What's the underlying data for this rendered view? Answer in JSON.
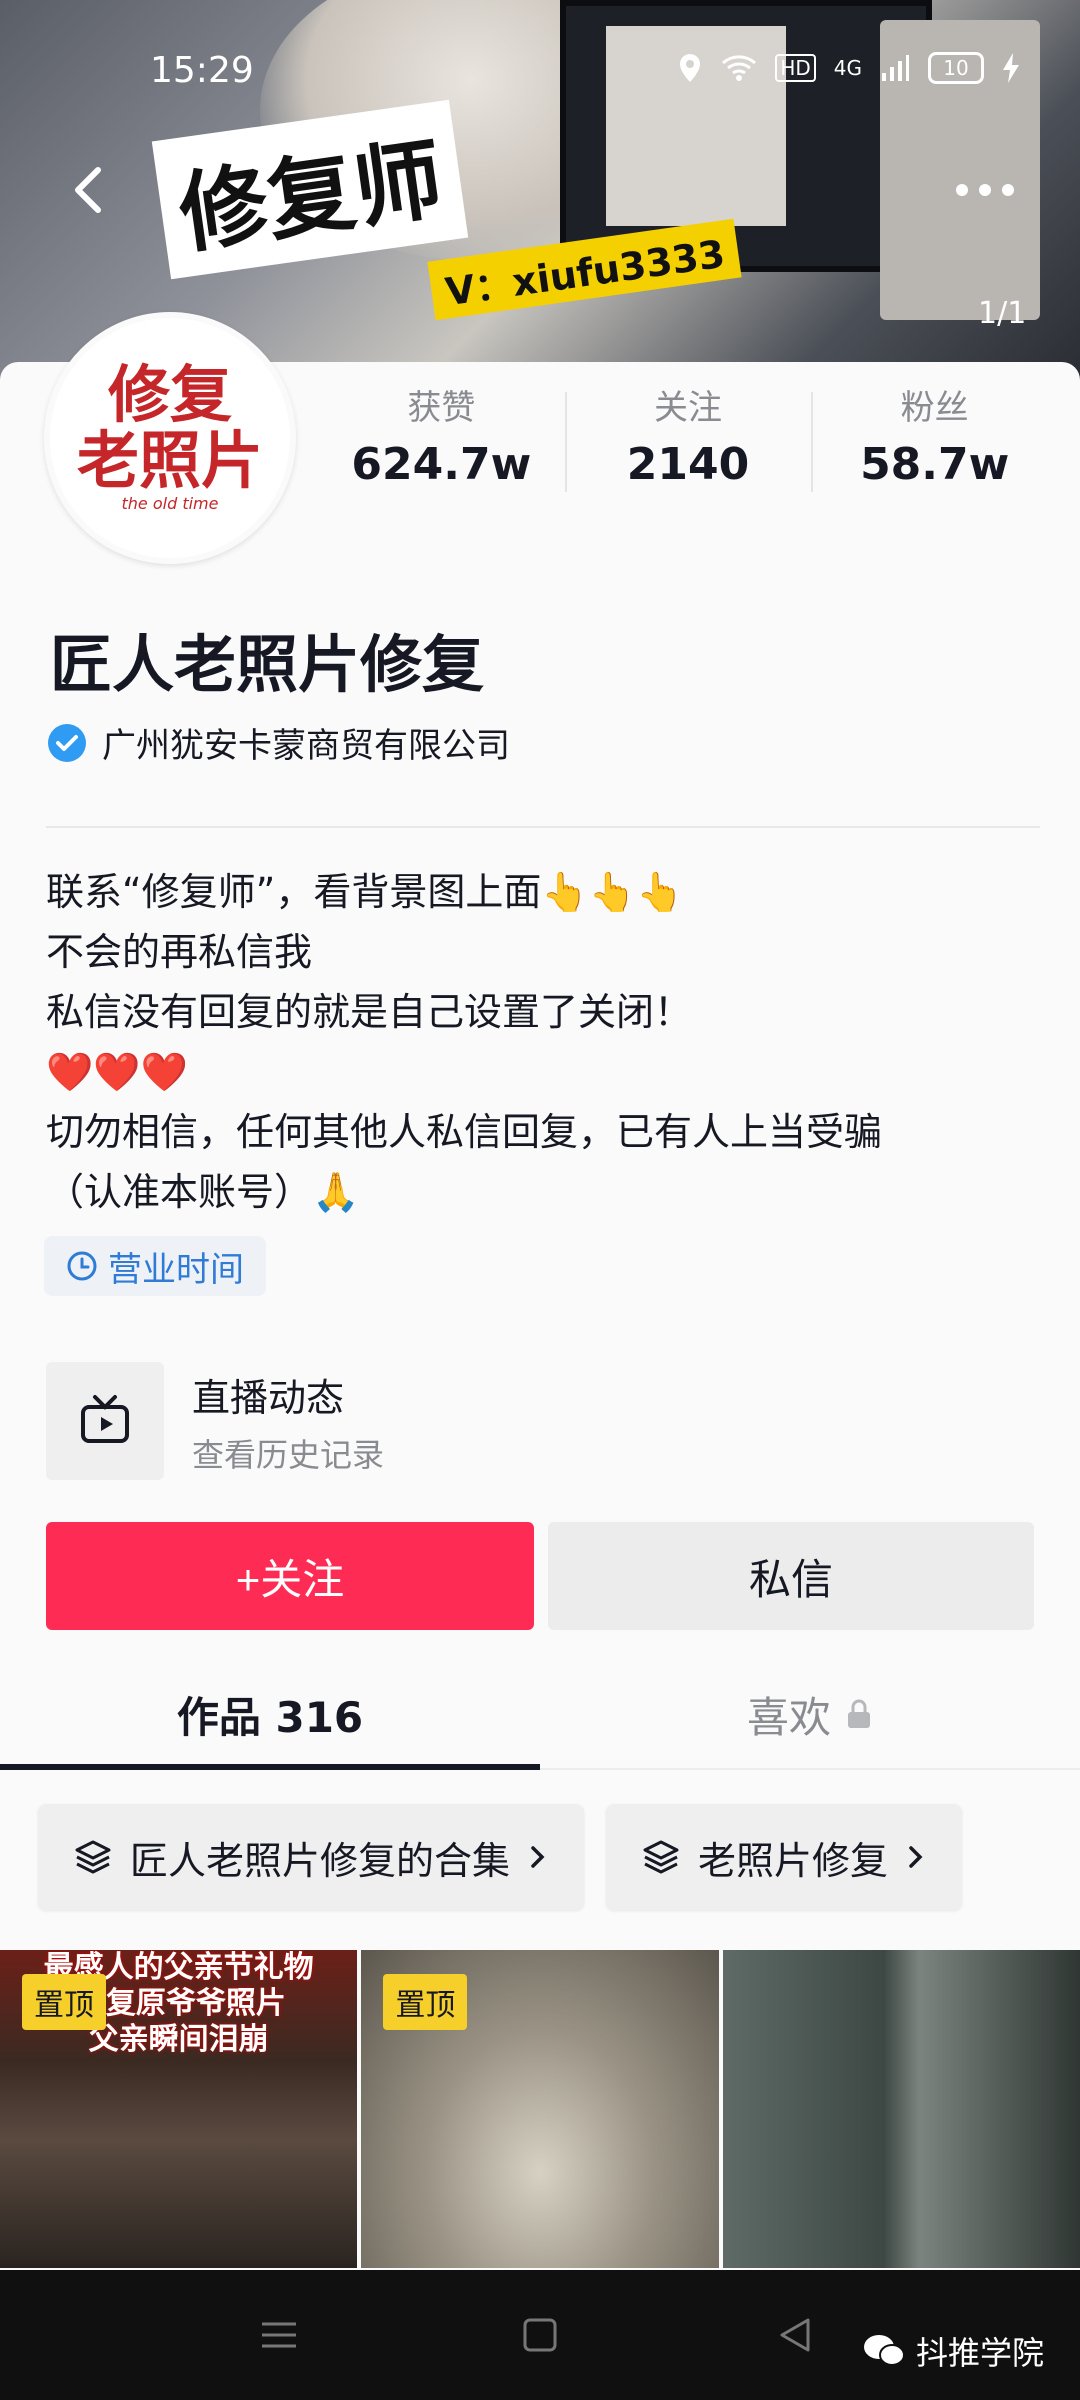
{
  "status_bar": {
    "time": "15:29",
    "network": "4G",
    "hd": "HD",
    "battery": "10"
  },
  "banner": {
    "title": "修复师",
    "subtitle": "V：xiufu3333",
    "page_counter": "1/1"
  },
  "avatar": {
    "line1": "修复",
    "line2": "老照片",
    "line3": "the old time"
  },
  "stats": [
    {
      "label": "获赞",
      "value": "624.7w"
    },
    {
      "label": "关注",
      "value": "2140"
    },
    {
      "label": "粉丝",
      "value": "58.7w"
    }
  ],
  "profile": {
    "name": "匠人老照片修复",
    "verified_org": "广州犹安卡蒙商贸有限公司"
  },
  "bio": [
    "联系“修复师”，看背景图上面👆👆👆",
    "不会的再私信我",
    "私信没有回复的就是自己设置了关闭！",
    "❤️❤️❤️",
    "切勿相信，任何其他人私信回复，已有人上当受骗",
    "（认准本账号）🙏"
  ],
  "business_hours_label": "营业时间",
  "live": {
    "title": "直播动态",
    "subtitle": "查看历史记录"
  },
  "actions": {
    "follow": "+关注",
    "message": "私信"
  },
  "tabs": [
    {
      "label": "作品 316"
    },
    {
      "label": "喜欢"
    }
  ],
  "collections": [
    {
      "label": "匠人老照片修复的合集"
    },
    {
      "label": "老照片修复"
    }
  ],
  "videos": [
    {
      "pin": "置顶",
      "overlay": "最感人的父亲节礼物\nAI复原爷爷照片\n父亲瞬间泪崩"
    },
    {
      "pin": "置顶",
      "overlay": ""
    },
    {
      "pin": "",
      "overlay": ""
    }
  ],
  "watermark": "抖推学院",
  "colors": {
    "follow": "#fe2c55",
    "verified": "#2f9bf2",
    "pin": "#f6cf2a"
  }
}
